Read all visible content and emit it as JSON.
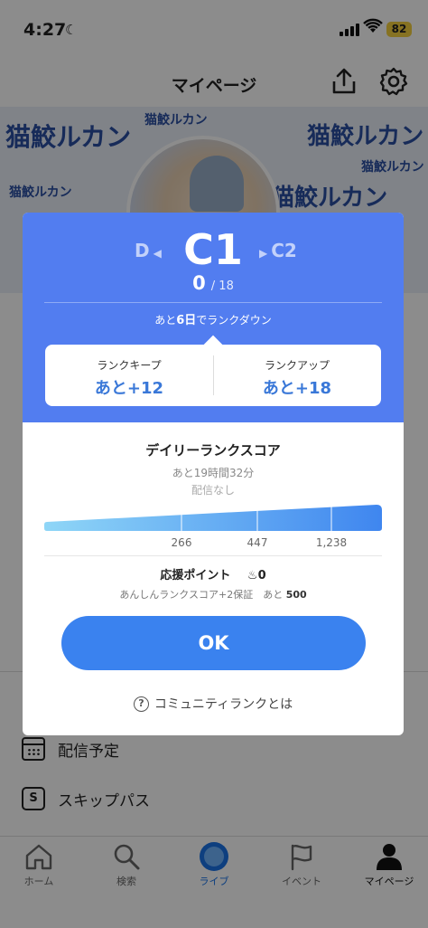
{
  "status_bar": {
    "time": "4:27",
    "battery": "82"
  },
  "header": {
    "title": "マイページ"
  },
  "banner": {
    "logo_text": "猫鮫ルカン"
  },
  "menu": {
    "items": [
      {
        "label": "配信予定",
        "icon": "calendar-icon"
      },
      {
        "label": "スキップパス",
        "icon": "skip-pass-icon"
      }
    ]
  },
  "tabs": [
    {
      "label": "ホーム",
      "icon": "home-icon"
    },
    {
      "label": "検索",
      "icon": "search-icon"
    },
    {
      "label": "ライブ",
      "icon": "live-icon"
    },
    {
      "label": "イベント",
      "icon": "flag-icon"
    },
    {
      "label": "マイページ",
      "icon": "person-icon"
    }
  ],
  "modal": {
    "prev_rank": "D",
    "current_rank": "C1",
    "next_rank": "C2",
    "score": "0",
    "score_max": "18",
    "rankdown_prefix": "あと",
    "rankdown_days": "6日",
    "rankdown_suffix": "でランクダウン",
    "keep_label": "ランクキープ",
    "keep_value": "あと+12",
    "up_label": "ランクアップ",
    "up_value": "あと+18",
    "daily_title": "デイリーランクスコア",
    "daily_remaining": "あと19時間32分",
    "daily_status": "配信なし",
    "support_label": "応援ポイント",
    "support_value": "0",
    "support_sub_text": "あんしんランクスコア+2保証　あと",
    "support_sub_value": "500",
    "ok_label": "OK",
    "community_link": "コミュニティランクとは"
  },
  "score_scale": {
    "ticks": [
      "266",
      "447",
      "1,238"
    ],
    "tick_values": [
      266,
      447,
      1238
    ]
  },
  "colors": {
    "modal_top": "#527df0",
    "accent": "#3a82ef",
    "value_text": "#3a78d8"
  }
}
